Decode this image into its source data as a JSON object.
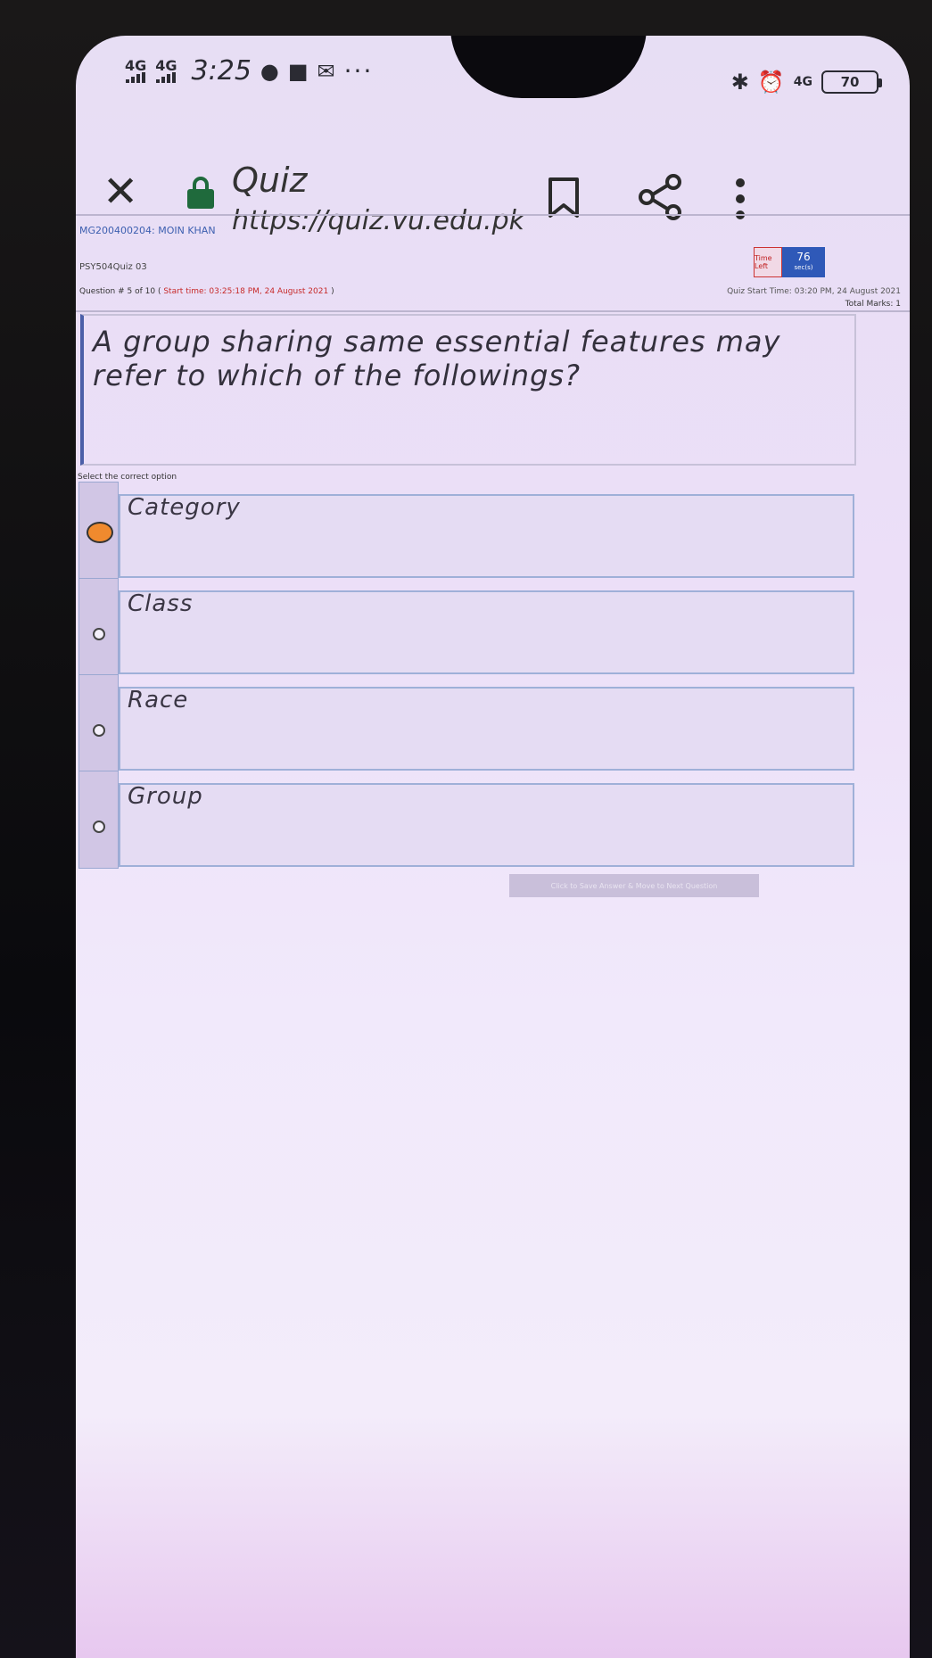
{
  "status_bar": {
    "network1": "4G",
    "network2": "4G",
    "time": "3:25",
    "more": "···",
    "right_network": "4G",
    "battery": "70"
  },
  "browser": {
    "title": "Quiz",
    "url": "https://quiz.vu.edu.pk"
  },
  "quiz": {
    "student": "MG200400204: MOIN KHAN",
    "quiz_code": "PSY504Quiz 03",
    "time_left_label": "Time Left",
    "time_left_value": "76",
    "time_left_unit": "sec(s)",
    "start_time": "Quiz Start Time: 03:20 PM, 24 August 2021",
    "question_prefix": "Question # 5 of 10 (",
    "question_start": "Start time: 03:25:18 PM, 24 August 2021",
    "question_suffix": ")",
    "total_marks": "Total Marks: 1",
    "question_text": "A group sharing same essential features may refer to which of the followings?",
    "select_label": "Select the correct option",
    "options": [
      {
        "label": "Category",
        "selected": true
      },
      {
        "label": "Class",
        "selected": false
      },
      {
        "label": "Race",
        "selected": false
      },
      {
        "label": "Group",
        "selected": false
      }
    ],
    "save_button": "Click to Save Answer & Move to Next Question"
  },
  "colors": {
    "selected_radio": "#f08a2e",
    "lock": "#1f6a3c",
    "timer": "#2f59b8"
  }
}
